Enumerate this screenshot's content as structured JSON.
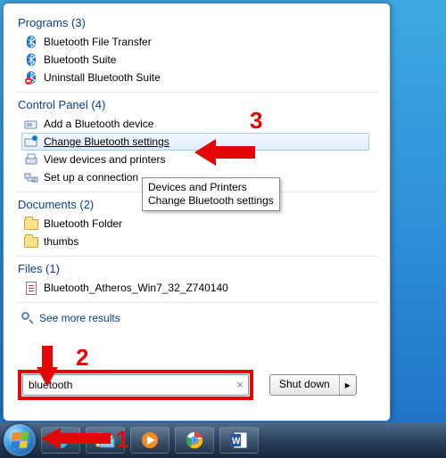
{
  "sections": {
    "programs": {
      "header": "Programs (3)",
      "items": [
        "Bluetooth File Transfer",
        "Bluetooth Suite",
        "Uninstall Bluetooth Suite"
      ]
    },
    "control_panel": {
      "header": "Control Panel (4)",
      "items": [
        "Add a Bluetooth device",
        "Change Bluetooth settings",
        "View devices and printers",
        "Set up a connection"
      ],
      "highlight_index": 1
    },
    "documents": {
      "header": "Documents (2)",
      "items": [
        "Bluetooth Folder",
        "thumbs"
      ]
    },
    "files": {
      "header": "Files (1)",
      "items": [
        "Bluetooth_Atheros_Win7_32_Z740140"
      ]
    }
  },
  "tooltip": {
    "line1": "Devices and Printers",
    "line2": "Change Bluetooth settings"
  },
  "see_more": "See more results",
  "search": {
    "value": "bluetooth",
    "clear": "×"
  },
  "shutdown": {
    "label": "Shut down",
    "arrow": "▸"
  },
  "annotations": {
    "n1": "1",
    "n2": "2",
    "n3": "3"
  }
}
